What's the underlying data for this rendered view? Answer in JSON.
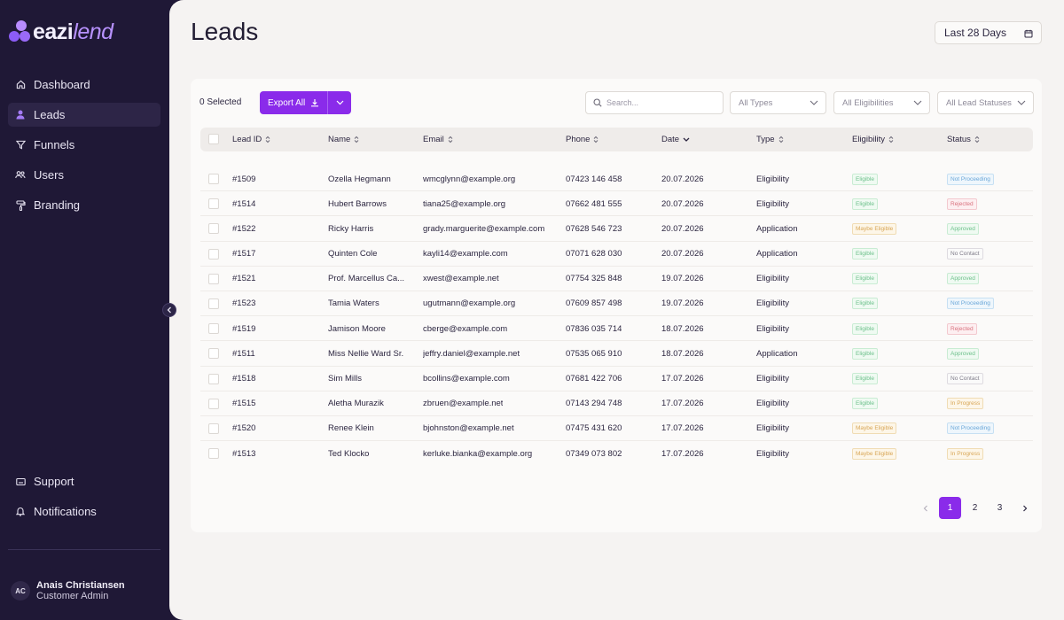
{
  "brand": {
    "name_part1": "eazi",
    "name_part2": "lend"
  },
  "sidebar": {
    "items": [
      {
        "label": "Dashboard",
        "icon": "home-icon"
      },
      {
        "label": "Leads",
        "icon": "person-icon",
        "active": true
      },
      {
        "label": "Funnels",
        "icon": "funnel-icon"
      },
      {
        "label": "Users",
        "icon": "users-icon"
      },
      {
        "label": "Branding",
        "icon": "paint-roller-icon"
      }
    ],
    "bottom_items": [
      {
        "label": "Support",
        "icon": "support-icon"
      },
      {
        "label": "Notifications",
        "icon": "bell-icon"
      }
    ],
    "user": {
      "initials": "AC",
      "name": "Anais Christiansen",
      "role": "Customer Admin"
    }
  },
  "header": {
    "title": "Leads",
    "date_range": "Last 28 Days"
  },
  "toolbar": {
    "selected_text": "0 Selected",
    "export_label": "Export All",
    "search_placeholder": "Search...",
    "filters": {
      "types": "All Types",
      "eligibilities": "All Eligibilities",
      "statuses": "All Lead Statuses"
    }
  },
  "table": {
    "columns": [
      "Lead ID",
      "Name",
      "Email",
      "Phone",
      "Date",
      "Type",
      "Eligibility",
      "Status"
    ],
    "sort_column": "Date",
    "rows": [
      {
        "id": "#1509",
        "name": "Ozella Hegmann",
        "email": "wmcglynn@example.org",
        "phone": "07423 146 458",
        "date": "20.07.2026",
        "type": "Eligibility",
        "eligibility": "Eligible",
        "status": "Not Proceeding"
      },
      {
        "id": "#1514",
        "name": "Hubert Barrows",
        "email": "tiana25@example.org",
        "phone": "07662 481 555",
        "date": "20.07.2026",
        "type": "Eligibility",
        "eligibility": "Eligible",
        "status": "Rejected"
      },
      {
        "id": "#1522",
        "name": "Ricky Harris",
        "email": "grady.marguerite@example.com",
        "phone": "07628 546 723",
        "date": "20.07.2026",
        "type": "Application",
        "eligibility": "Maybe Eligible",
        "status": "Approved"
      },
      {
        "id": "#1517",
        "name": "Quinten Cole",
        "email": "kayli14@example.com",
        "phone": "07071 628 030",
        "date": "20.07.2026",
        "type": "Application",
        "eligibility": "Eligible",
        "status": "No Contact"
      },
      {
        "id": "#1521",
        "name": "Prof. Marcellus Ca...",
        "email": "xwest@example.net",
        "phone": "07754 325 848",
        "date": "19.07.2026",
        "type": "Eligibility",
        "eligibility": "Eligible",
        "status": "Approved"
      },
      {
        "id": "#1523",
        "name": "Tamia Waters",
        "email": "ugutmann@example.org",
        "phone": "07609 857 498",
        "date": "19.07.2026",
        "type": "Eligibility",
        "eligibility": "Eligible",
        "status": "Not Proceeding"
      },
      {
        "id": "#1519",
        "name": "Jamison Moore",
        "email": "cberge@example.com",
        "phone": "07836 035 714",
        "date": "18.07.2026",
        "type": "Eligibility",
        "eligibility": "Eligible",
        "status": "Rejected"
      },
      {
        "id": "#1511",
        "name": "Miss Nellie Ward Sr.",
        "email": "jeffry.daniel@example.net",
        "phone": "07535 065 910",
        "date": "18.07.2026",
        "type": "Application",
        "eligibility": "Eligible",
        "status": "Approved"
      },
      {
        "id": "#1518",
        "name": "Sim Mills",
        "email": "bcollins@example.com",
        "phone": "07681 422 706",
        "date": "17.07.2026",
        "type": "Eligibility",
        "eligibility": "Eligible",
        "status": "No Contact"
      },
      {
        "id": "#1515",
        "name": "Aletha Murazik",
        "email": "zbruen@example.net",
        "phone": "07143 294 748",
        "date": "17.07.2026",
        "type": "Eligibility",
        "eligibility": "Eligible",
        "status": "In Progress"
      },
      {
        "id": "#1520",
        "name": "Renee Klein",
        "email": "bjohnston@example.net",
        "phone": "07475 431 620",
        "date": "17.07.2026",
        "type": "Eligibility",
        "eligibility": "Maybe Eligible",
        "status": "Not Proceeding"
      },
      {
        "id": "#1513",
        "name": "Ted Klocko",
        "email": "kerluke.bianka@example.org",
        "phone": "07349 073 802",
        "date": "17.07.2026",
        "type": "Eligibility",
        "eligibility": "Maybe Eligible",
        "status": "In Progress"
      }
    ]
  },
  "pagination": {
    "pages": [
      "1",
      "2",
      "3"
    ],
    "current": "1"
  },
  "colors": {
    "accent": "#8a2bea",
    "sidebar_bg": "#1f1836",
    "main_bg": "#f5f3f2"
  }
}
